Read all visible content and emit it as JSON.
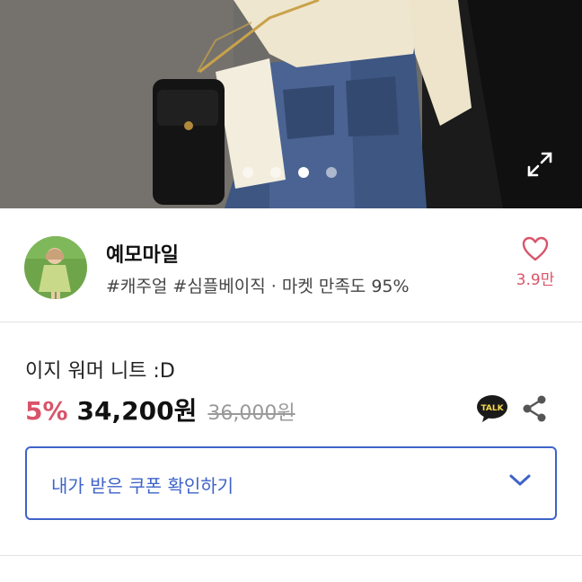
{
  "gallery": {
    "dots": [
      false,
      false,
      true,
      false
    ]
  },
  "seller": {
    "name": "예모마일",
    "tags": "#캐주얼 #심플베이직 · 마켓 만족도 95%",
    "like_count": "3.9만"
  },
  "product": {
    "title": "이지 워머 니트 :D",
    "discount": "5%",
    "price": "34,200원",
    "original_price": "36,000원"
  },
  "icons": {
    "talk": "TALK",
    "share": "share-icon",
    "expand": "expand-icon",
    "heart": "heart-icon"
  },
  "coupon": {
    "label": "내가 받은 쿠폰 확인하기"
  },
  "colors": {
    "accent_pink": "#d9546a",
    "accent_blue": "#3f63c9"
  }
}
